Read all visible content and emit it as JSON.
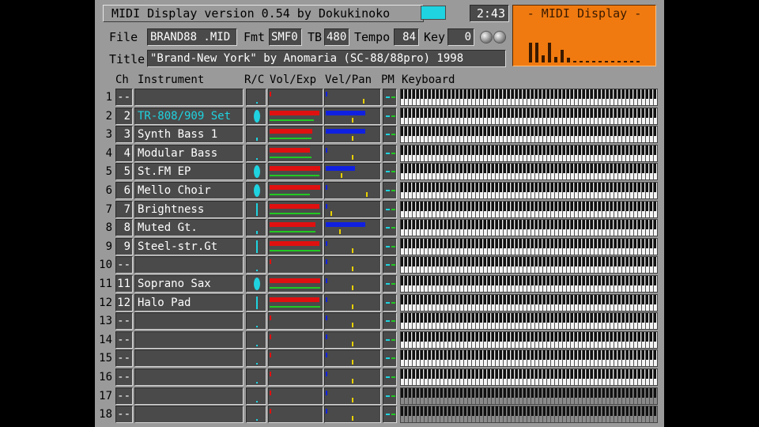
{
  "app": {
    "title": "MIDI Display  version 0.54  by Dokukinoko",
    "time": "2:43",
    "logo_text": "- MIDI Display -",
    "indicator_color": "#1fd3e0",
    "logo_color": "#f07a10"
  },
  "file_info": {
    "file_label": "File",
    "file_value": "BRAND88 .MID",
    "fmt_label": "Fmt",
    "fmt_value": "SMF0",
    "tb_label": "TB",
    "tb_value": "480",
    "tempo_label": "Tempo",
    "tempo_value": "84",
    "key_label": "Key",
    "key_value": "0",
    "title_label": "Title",
    "title_value": "\"Brand-New York\"  by Anomaria (SC-88/88pro)  1998"
  },
  "headers": {
    "ch": "Ch",
    "instrument": "Instrument",
    "rc": "R/C",
    "vol_exp": "Vol/Exp",
    "vel_pan": "Vel/Pan",
    "pm": "PM",
    "keyboard": "Keyboard"
  },
  "colors": {
    "vol": "#e01010",
    "vel": "#1020e0",
    "exp": "#22c822",
    "pan": "#e8d000",
    "drum_text": "#1fd3e0",
    "indicator": "#1fd3e0"
  },
  "channels": [
    {
      "ch": "1",
      "num": "--",
      "name": "",
      "vol": 0,
      "exp": 0,
      "vel": 0,
      "pan": 0.72,
      "rc": "none",
      "dim": false
    },
    {
      "ch": "2",
      "num": "2",
      "name": "TR-808/909 Set",
      "vol": 0.95,
      "exp": 0.85,
      "vel": 0.74,
      "pan": 0.5,
      "rc": "blob",
      "drum": true,
      "dim": false
    },
    {
      "ch": "3",
      "num": "3",
      "name": "Synth Bass 1",
      "vol": 0.82,
      "exp": 0.8,
      "vel": 0.74,
      "pan": 0.5,
      "rc": "dot",
      "dim": false
    },
    {
      "ch": "4",
      "num": "4",
      "name": "Modular Bass",
      "vol": 0.78,
      "exp": 0.8,
      "vel": 0,
      "pan": 0.5,
      "rc": "none",
      "dim": false
    },
    {
      "ch": "5",
      "num": "5",
      "name": "St.FM EP",
      "vol": 0.97,
      "exp": 0.95,
      "vel": 0.55,
      "pan": 0.28,
      "rc": "blob",
      "dim": false
    },
    {
      "ch": "6",
      "num": "6",
      "name": "Mello Choir",
      "vol": 0.97,
      "exp": 0.78,
      "vel": 0,
      "pan": 0.78,
      "rc": "blob",
      "dim": false
    },
    {
      "ch": "7",
      "num": "7",
      "name": "Brightness",
      "vol": 0.95,
      "exp": 0.97,
      "vel": 0,
      "pan": 0.08,
      "rc": "line",
      "dim": false
    },
    {
      "ch": "8",
      "num": "8",
      "name": "Muted Gt.",
      "vol": 0.88,
      "exp": 0.88,
      "vel": 0.74,
      "pan": 0.25,
      "rc": "dot",
      "dim": false
    },
    {
      "ch": "9",
      "num": "9",
      "name": "Steel-str.Gt",
      "vol": 0.95,
      "exp": 0.97,
      "vel": 0,
      "pan": 0.5,
      "rc": "line",
      "dim": false
    },
    {
      "ch": "10",
      "num": "--",
      "name": "",
      "vol": 0,
      "exp": 0,
      "vel": 0,
      "pan": 0.5,
      "rc": "none",
      "dim": false
    },
    {
      "ch": "11",
      "num": "11",
      "name": "Soprano Sax",
      "vol": 0.97,
      "exp": 0.97,
      "vel": 0,
      "pan": 0.5,
      "rc": "blob",
      "dim": false
    },
    {
      "ch": "12",
      "num": "12",
      "name": "Halo Pad",
      "vol": 0.95,
      "exp": 0.97,
      "vel": 0,
      "pan": 0.5,
      "rc": "line",
      "dim": false
    },
    {
      "ch": "13",
      "num": "--",
      "name": "",
      "vol": 0,
      "exp": 0,
      "vel": 0,
      "pan": 0.5,
      "rc": "none",
      "dim": false
    },
    {
      "ch": "14",
      "num": "--",
      "name": "",
      "vol": 0,
      "exp": 0,
      "vel": 0,
      "pan": 0.5,
      "rc": "none",
      "dim": false
    },
    {
      "ch": "15",
      "num": "--",
      "name": "",
      "vol": 0,
      "exp": 0,
      "vel": 0,
      "pan": 0.5,
      "rc": "none",
      "dim": false
    },
    {
      "ch": "16",
      "num": "--",
      "name": "",
      "vol": 0,
      "exp": 0,
      "vel": 0,
      "pan": 0.5,
      "rc": "none",
      "dim": false
    },
    {
      "ch": "17",
      "num": "--",
      "name": "",
      "vol": 0,
      "exp": 0,
      "vel": 0,
      "pan": 0.5,
      "rc": "none",
      "dim": true
    },
    {
      "ch": "18",
      "num": "--",
      "name": "",
      "vol": 0,
      "exp": 0,
      "vel": 0,
      "pan": 0.5,
      "rc": "none",
      "dim": true
    }
  ],
  "logo_levels": [
    0.55,
    0.55,
    0.2,
    0.55,
    0.15,
    0.35,
    0.12,
    0.05,
    0.05,
    0.05,
    0.05,
    0.05,
    0.05,
    0.05,
    0.05,
    0.05,
    0.05,
    0.05
  ]
}
